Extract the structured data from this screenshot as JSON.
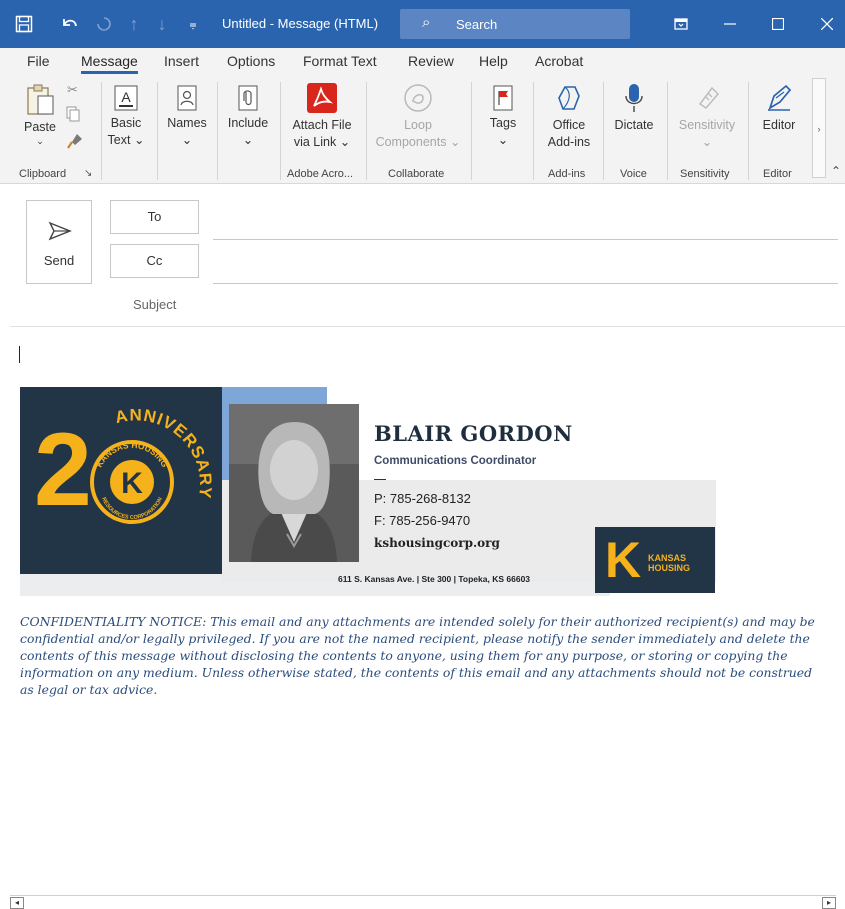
{
  "titlebar": {
    "title": "Untitled  -  Message (HTML)",
    "search_placeholder": "Search",
    "icons": [
      "save-icon",
      "undo-icon",
      "redo-icon",
      "up-arrow-icon",
      "down-arrow-icon",
      "customize-icon"
    ],
    "accent": "#2b64ae"
  },
  "menu": {
    "tabs": [
      "File",
      "Message",
      "Insert",
      "Options",
      "Format Text",
      "Review",
      "Help",
      "Acrobat"
    ],
    "active": "Message"
  },
  "ribbon": {
    "paste": "Paste",
    "basic_text": "Basic",
    "basic_text2": "Text",
    "names": "Names",
    "include": "Include",
    "attach_file": "Attach File",
    "attach_file2": "via Link",
    "loop": "Loop",
    "loop2": "Components",
    "tags": "Tags",
    "office_addins": "Office",
    "office_addins2": "Add-ins",
    "dictate": "Dictate",
    "sensitivity": "Sensitivity",
    "editor": "Editor",
    "groups": {
      "clipboard": "Clipboard",
      "adobe": "Adobe Acro...",
      "collaborate": "Collaborate",
      "addins": "Add-ins",
      "voice": "Voice",
      "sensitivity": "Sensitivity",
      "editor": "Editor"
    }
  },
  "compose": {
    "send": "Send",
    "to": "To",
    "cc": "Cc",
    "subject": "Subject"
  },
  "signature": {
    "anniversary": "ANNIVERSARY",
    "anniversary_number": "2",
    "badge_top": "KANSAS HOUSING",
    "badge_bottom": "RESOURCES CORPORATION",
    "name": "BLAIR GORDON",
    "title": "Communications Coordinator",
    "phone": "P: 785-268-8132",
    "fax": "F: 785-256-9470",
    "website": "kshousingcorp.org",
    "address": "611 S. Kansas Ave. | Ste 300  | Topeka, KS 66603",
    "logo_line1": "KANSAS",
    "logo_line2": "HOUSING",
    "brand_yellow": "#f5b21b",
    "brand_navy": "#223547"
  },
  "notice": "CONFIDENTIALITY NOTICE: This email and any attachments are intended solely for their authorized recipient(s) and may be confidential and/or legally privileged. If you are not the named recipient, please notify the sender immediately and delete the contents of this message without disclosing the contents to anyone, using them for any purpose, or storing or copying the information on any medium. Unless otherwise stated, the contents of this email and any attachments should not be construed as legal or tax advice."
}
